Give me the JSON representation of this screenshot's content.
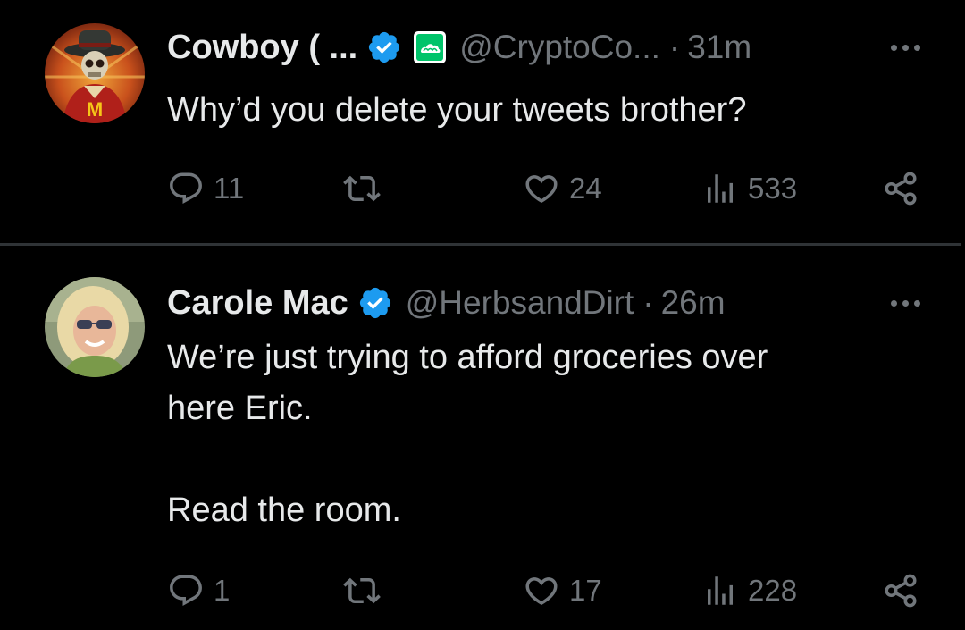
{
  "colors": {
    "background": "#000000",
    "text": "#e7e9ea",
    "secondary": "#71767b",
    "verified": "#1d9bf0",
    "affiliate_badge": "#00c46a",
    "divider": "#2f3336"
  },
  "tweets": [
    {
      "display_name": "Cowboy ( ...",
      "verified": true,
      "affiliate_badge_icon": "cloud-badge-icon",
      "handle": "@CryptoCo...",
      "separator": "·",
      "time": "31m",
      "text_lines": [
        "Why’d you delete your tweets brother?"
      ],
      "replies": "11",
      "reposts": "",
      "likes": "24",
      "views": "533"
    },
    {
      "display_name": "Carole Mac",
      "verified": true,
      "handle": "@HerbsandDirt",
      "separator": "·",
      "time": "26m",
      "text_lines": [
        "We’re just trying to afford groceries over",
        "here Eric.",
        "Read the room."
      ],
      "replies": "1",
      "reposts": "",
      "likes": "17",
      "views": "228"
    }
  ]
}
